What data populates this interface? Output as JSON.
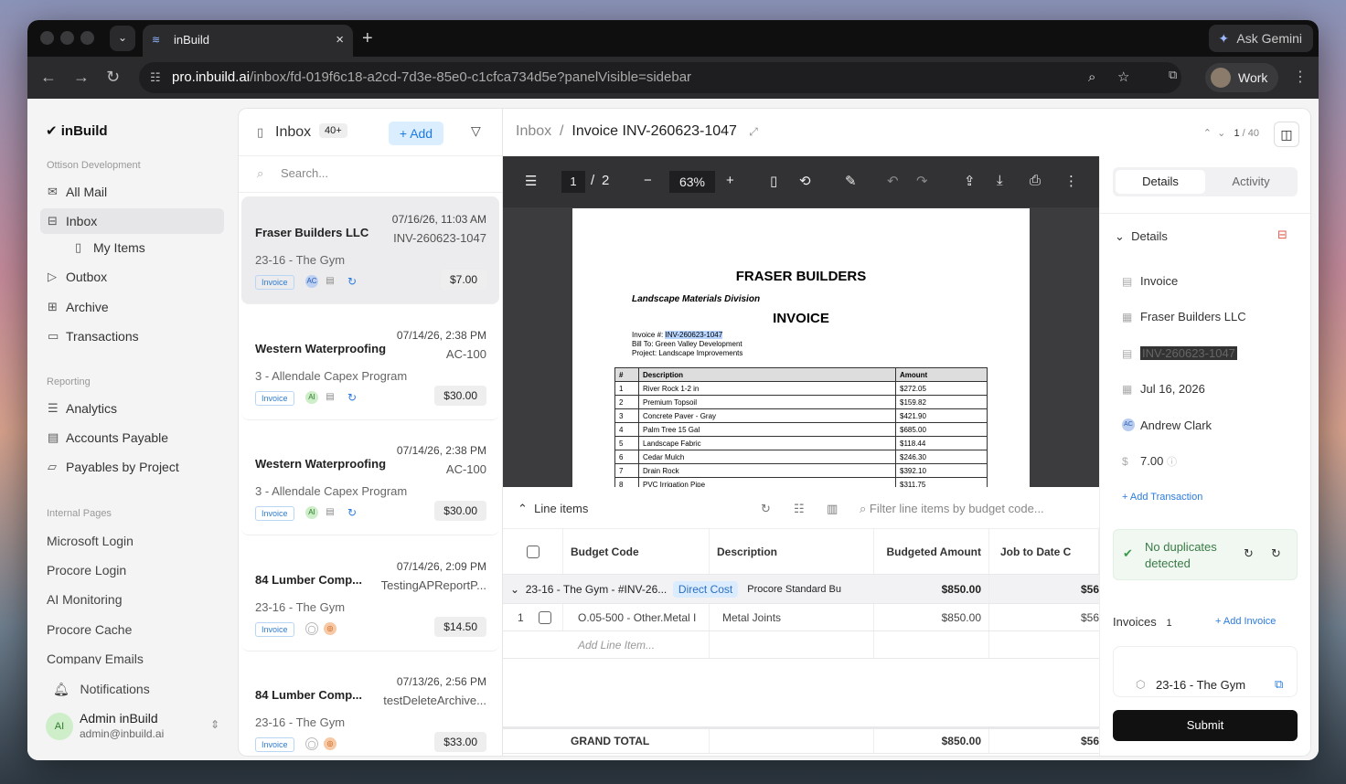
{
  "browser": {
    "tab_title": "inBuild",
    "ask": "Ask Gemini",
    "url_host": "pro.inbuild.ai",
    "url_path": "/inbox/fd-019f6c18-a2cd-7d3e-85e0-c1cfca734d5e?panelVisible=sidebar",
    "profile": "Work"
  },
  "sidebar": {
    "logo": "inBuild",
    "org": "Ottison Development",
    "items": [
      {
        "label": "All Mail",
        "icon": "mail-icon"
      },
      {
        "label": "Inbox",
        "icon": "inbox-icon"
      },
      {
        "label": "My Items",
        "icon": "bookmark-icon"
      },
      {
        "label": "Outbox",
        "icon": "send-icon"
      },
      {
        "label": "Archive",
        "icon": "archive-icon"
      },
      {
        "label": "Transactions",
        "icon": "card-icon"
      }
    ],
    "reporting": "Reporting",
    "reports": [
      {
        "label": "Analytics"
      },
      {
        "label": "Accounts Payable"
      },
      {
        "label": "Payables by Project"
      }
    ],
    "internal": "Internal Pages",
    "pages": [
      "Microsoft Login",
      "Procore Login",
      "AI Monitoring",
      "Procore Cache",
      "Company Emails"
    ],
    "notifications": "Notifications",
    "user": {
      "initials": "AI",
      "name": "Admin inBuild",
      "email": "admin@inbuild.ai"
    }
  },
  "inbox": {
    "title": "Inbox",
    "count": "40+",
    "add": "Add",
    "search_placeholder": "Search...",
    "items": [
      {
        "company": "Fraser Builders LLC",
        "date": "07/16/26, 11:03 AM",
        "ref": "INV-260623-1047",
        "project": "23-16 - The Gym",
        "badge": "Invoice",
        "initials": "AC",
        "amount": "$7.00"
      },
      {
        "company": "Western Waterproofing",
        "date": "07/14/26, 2:38 PM",
        "ref": "AC-100",
        "project": "3 - Allendale Capex Program",
        "badge": "Invoice",
        "initials": "AI",
        "amount": "$30.00"
      },
      {
        "company": "Western Waterproofing",
        "date": "07/14/26, 2:38 PM",
        "ref": "AC-100",
        "project": "3 - Allendale Capex Program",
        "badge": "Invoice",
        "initials": "AI",
        "amount": "$30.00"
      },
      {
        "company": "84 Lumber Comp...",
        "date": "07/14/26, 2:09 PM",
        "ref": "TestingAPReportP...",
        "project": "23-16 - The Gym",
        "badge": "Invoice",
        "initials": "",
        "amount": "$14.50"
      },
      {
        "company": "84 Lumber Comp...",
        "date": "07/13/26, 2:56 PM",
        "ref": "testDeleteArchive...",
        "project": "23-16 - The Gym",
        "badge": "Invoice",
        "initials": "",
        "amount": "$33.00"
      }
    ]
  },
  "header": {
    "crumb": "Inbox",
    "sep": "/",
    "title": "Invoice INV-260623-1047",
    "pager": "1",
    "pager_total": "/ 40"
  },
  "pdf": {
    "page": "1",
    "sep": "/",
    "pages": "2",
    "zoom": "63%",
    "doc": {
      "company": "FRASER BUILDERS",
      "division": "Landscape Materials Division",
      "heading": "INVOICE",
      "inv_label": "Invoice #:",
      "inv_no": "INV-260623-1047",
      "bill": "Bill To: Green Valley Development",
      "project": "Project: Landscape Improvements",
      "cols": [
        "#",
        "Description",
        "Amount"
      ],
      "rows": [
        [
          "1",
          "River Rock 1-2 in",
          "$272.05"
        ],
        [
          "2",
          "Premium Topsoil",
          "$159.82"
        ],
        [
          "3",
          "Concrete Paver - Gray",
          "$421.90"
        ],
        [
          "4",
          "Palm Tree 15 Gal",
          "$685.00"
        ],
        [
          "5",
          "Landscape Fabric",
          "$118.44"
        ],
        [
          "6",
          "Cedar Mulch",
          "$246.30"
        ],
        [
          "7",
          "Drain Rock",
          "$392.10"
        ],
        [
          "8",
          "PVC Irrigation Pipe",
          "$311.75"
        ]
      ]
    }
  },
  "lineitems": {
    "title": "Line items",
    "filter": "Filter line items by budget code...",
    "cols": [
      "Budget Code",
      "Description",
      "Budgeted Amount",
      "Job to Date C"
    ],
    "group": {
      "code": "23-16 - The Gym - #INV-26...",
      "tag": "Direct Cost",
      "desc": "Procore Standard Bu",
      "amount": "$850.00",
      "jtd": "$56"
    },
    "row": {
      "num": "1",
      "code": "O.05-500 - Other.Metal I",
      "desc": "Metal Joints",
      "amount": "$850.00",
      "jtd": "$56"
    },
    "add": "Add Line Item...",
    "total_label": "GRAND TOTAL",
    "total": "$850.00",
    "total_jtd": "$56"
  },
  "details": {
    "tab_details": "Details",
    "tab_activity": "Activity",
    "section": "Details",
    "type": "Invoice",
    "vendor": "Fraser Builders LLC",
    "number": "INV-260623-1047",
    "date": "Jul 16, 2026",
    "initials": "AC",
    "assignee": "Andrew Clark",
    "amount": "7.00",
    "add_txn": "+ Add Transaction",
    "dup": "No duplicates detected",
    "invoices": "Invoices",
    "inv_count": "1",
    "add_invoice": "+ Add Invoice",
    "project": "23-16 - The Gym",
    "submit": "Submit"
  }
}
